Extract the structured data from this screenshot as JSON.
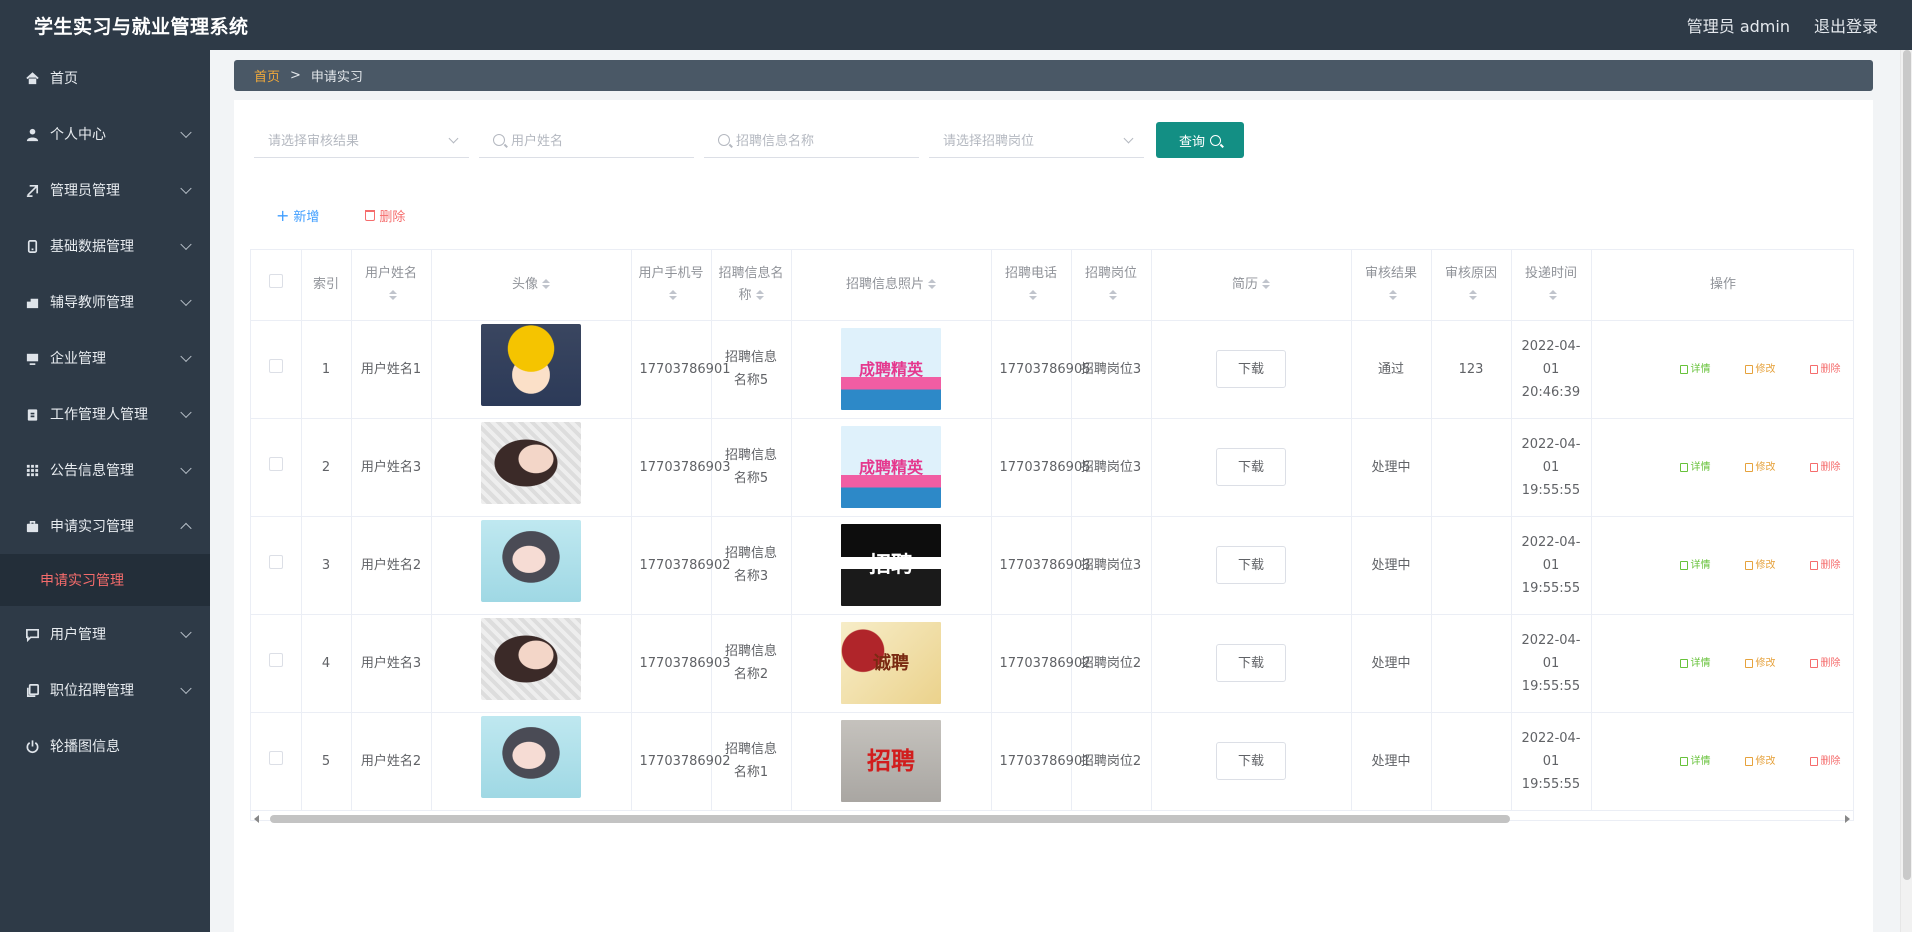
{
  "app": {
    "title": "学生实习与就业管理系统"
  },
  "header": {
    "user": "管理员 admin",
    "logout": "退出登录"
  },
  "sidebar": {
    "items": [
      {
        "label": "首页",
        "icon": "home-icon"
      },
      {
        "label": "个人中心",
        "icon": "user-icon"
      },
      {
        "label": "管理员管理",
        "icon": "admin-icon"
      },
      {
        "label": "基础数据管理",
        "icon": "data-icon"
      },
      {
        "label": "辅导教师管理",
        "icon": "teacher-icon"
      },
      {
        "label": "企业管理",
        "icon": "monitor-icon"
      },
      {
        "label": "工作管理人管理",
        "icon": "clipboard-icon"
      },
      {
        "label": "公告信息管理",
        "icon": "grid-icon"
      },
      {
        "label": "申请实习管理",
        "icon": "briefcase-icon"
      },
      {
        "label": "用户管理",
        "icon": "chat-icon"
      },
      {
        "label": "职位招聘管理",
        "icon": "copy-icon"
      },
      {
        "label": "轮播图信息",
        "icon": "power-icon"
      }
    ],
    "submenu_active": "申请实习管理"
  },
  "breadcrumb": {
    "home": "首页",
    "sep": ">",
    "current": "申请实习"
  },
  "filters": {
    "audit_result": "请选择审核结果",
    "user_name": "用户姓名",
    "job_info_name": "招聘信息名称",
    "job_position": "请选择招聘岗位",
    "query": "查询"
  },
  "actions": {
    "add": "新增",
    "delete": "删除"
  },
  "table": {
    "headers": {
      "index": "索引",
      "user_name": "用户姓名",
      "avatar": "头像",
      "user_phone": "用户手机号",
      "job_info_name": "招聘信息名称",
      "job_info_photo": "招聘信息照片",
      "job_phone": "招聘电话",
      "job_position": "招聘岗位",
      "resume": "简历",
      "audit_result": "审核结果",
      "audit_reason": "审核原因",
      "submit_time": "投递时间",
      "ops": "操作"
    },
    "rows": [
      {
        "index": "1",
        "user_name": "用户姓名1",
        "avatar": "av-1",
        "user_phone": "17703786901",
        "job_info_name": "招聘信息名称5",
        "poster": "po-5",
        "poster_text": "成聘精英",
        "job_phone": "17703786905",
        "job_position": "招聘岗位3",
        "resume": "下载",
        "audit_result": "通过",
        "audit_reason": "123",
        "submit_time": "2022-04-01 20:46:39"
      },
      {
        "index": "2",
        "user_name": "用户姓名3",
        "avatar": "av-3",
        "user_phone": "17703786903",
        "job_info_name": "招聘信息名称5",
        "poster": "po-5",
        "poster_text": "成聘精英",
        "job_phone": "17703786905",
        "job_position": "招聘岗位3",
        "resume": "下载",
        "audit_result": "处理中",
        "audit_reason": "",
        "submit_time": "2022-04-01 19:55:55"
      },
      {
        "index": "3",
        "user_name": "用户姓名2",
        "avatar": "av-2",
        "user_phone": "17703786902",
        "job_info_name": "招聘信息名称3",
        "poster": "po-3",
        "poster_text": "招聘",
        "job_phone": "17703786903",
        "job_position": "招聘岗位3",
        "resume": "下载",
        "audit_result": "处理中",
        "audit_reason": "",
        "submit_time": "2022-04-01 19:55:55"
      },
      {
        "index": "4",
        "user_name": "用户姓名3",
        "avatar": "av-3",
        "user_phone": "17703786903",
        "job_info_name": "招聘信息名称2",
        "poster": "po-2",
        "poster_text": "诚聘",
        "job_phone": "17703786902",
        "job_position": "招聘岗位2",
        "resume": "下载",
        "audit_result": "处理中",
        "audit_reason": "",
        "submit_time": "2022-04-01 19:55:55"
      },
      {
        "index": "5",
        "user_name": "用户姓名2",
        "avatar": "av-2",
        "user_phone": "17703786902",
        "job_info_name": "招聘信息名称1",
        "poster": "po-1",
        "poster_text": "招聘",
        "job_phone": "17703786901",
        "job_position": "招聘岗位2",
        "resume": "下载",
        "audit_result": "处理中",
        "audit_reason": "",
        "submit_time": "2022-04-01 19:55:55"
      }
    ],
    "ops": {
      "view": "详情",
      "edit": "修改",
      "delete": "删除"
    }
  },
  "colors": {
    "topbar": "#2e3a47",
    "accent": "#138f84",
    "danger": "#f56c6c",
    "primary": "#409eff"
  }
}
